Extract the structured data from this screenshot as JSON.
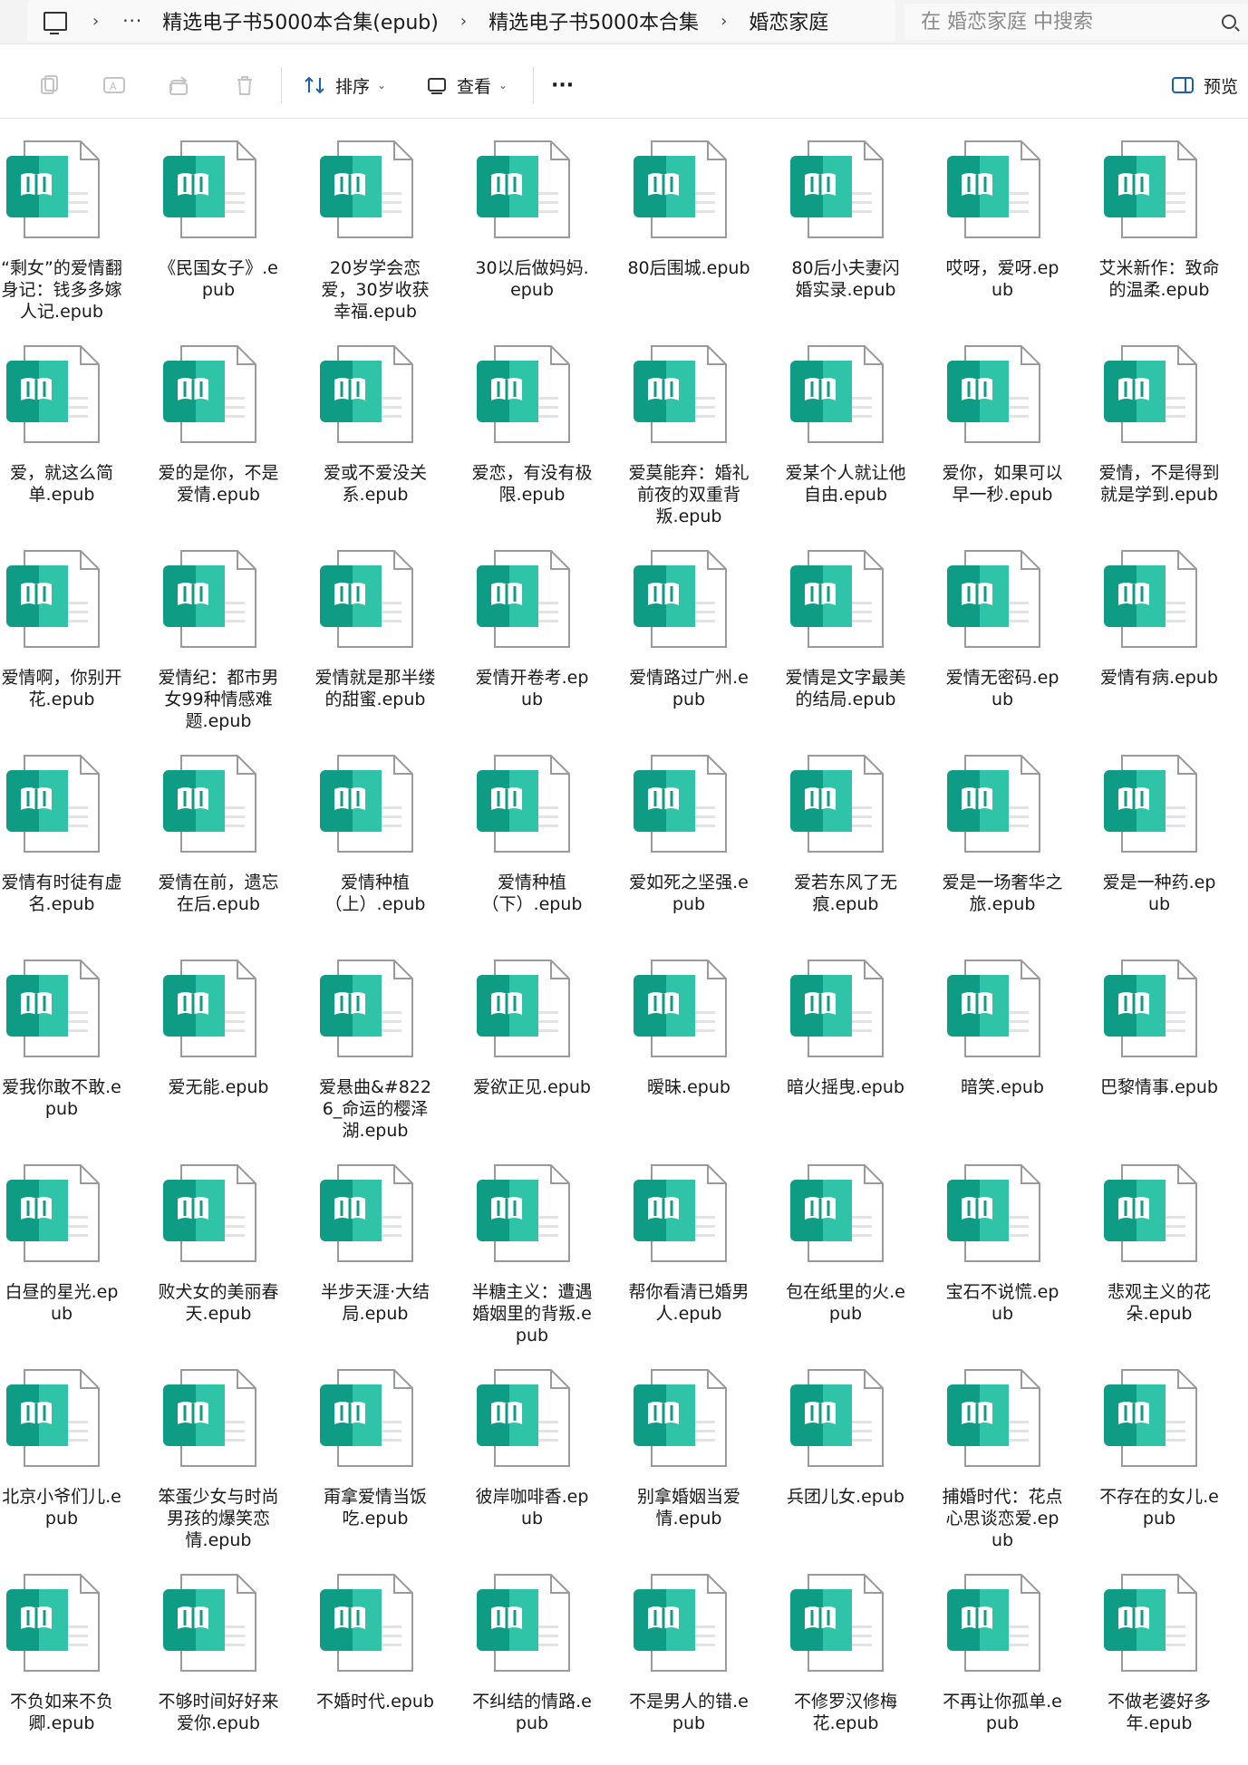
{
  "breadcrumb": {
    "more": "···",
    "items": [
      "精选电子书5000本合集(epub)",
      "精选电子书5000本合集",
      "婚恋家庭"
    ],
    "separator": "›"
  },
  "search": {
    "placeholder": "在 婚恋家庭 中搜索"
  },
  "toolbar": {
    "sort_label": "排序",
    "view_label": "查看",
    "more_label": "···",
    "preview_label": "预览"
  },
  "colors": {
    "icon_dark": "#0f9c85",
    "icon_light": "#2fc4a7",
    "page": "#ffffff",
    "page_border": "#9a9a9a"
  },
  "files": [
    "“剩女”的爱情翻身记：钱多多嫁人记.epub",
    "《民国女子》.epub",
    "20岁学会恋爱，30岁收获幸福.epub",
    "30以后做妈妈.epub",
    "80后围城.epub",
    "80后小夫妻闪婚实录.epub",
    "哎呀，爱呀.epub",
    "艾米新作：致命的温柔.epub",
    "爱，就这么简单.epub",
    "爱的是你，不是爱情.epub",
    "爱或不爱没关系.epub",
    "爱恋，有没有极限.epub",
    "爱莫能弃：婚礼前夜的双重背叛.epub",
    "爱某个人就让他自由.epub",
    "爱你，如果可以早一秒.epub",
    "爱情，不是得到就是学到.epub",
    "爱情啊，你别开花.epub",
    "爱情纪：都市男女99种情感难题.epub",
    "爱情就是那半缕的甜蜜.epub",
    "爱情开卷考.epub",
    "爱情路过广州.epub",
    "爱情是文字最美的结局.epub",
    "爱情无密码.epub",
    "爱情有病.epub",
    "爱情有时徒有虚名.epub",
    "爱情在前，遗忘在后.epub",
    "爱情种植（上）.epub",
    "爱情种植（下）.epub",
    "爱如死之坚强.epub",
    "爱若东风了无痕.epub",
    "爱是一场奢华之旅.epub",
    "爱是一种药.epub",
    "爱我你敢不敢.epub",
    "爱无能.epub",
    "爱悬曲&#8226_命运的樱泽湖.epub",
    "爱欲正见.epub",
    "暧昧.epub",
    "暗火摇曳.epub",
    "暗笑.epub",
    "巴黎情事.epub",
    "白昼的星光.epub",
    "败犬女的美丽春天.epub",
    "半步天涯·大结局.epub",
    "半糖主义：遭遇婚姻里的背叛.epub",
    "帮你看清已婚男人.epub",
    "包在纸里的火.epub",
    "宝石不说慌.epub",
    "悲观主义的花朵.epub",
    "北京小爷们儿.epub",
    "笨蛋少女与时尚男孩的爆笑恋情.epub",
    "甭拿爱情当饭吃.epub",
    "彼岸咖啡香.epub",
    "别拿婚姻当爱情.epub",
    "兵团儿女.epub",
    "捕婚时代：花点心思谈恋爱.epub",
    "不存在的女儿.epub",
    "不负如来不负卿.epub",
    "不够时间好好来爱你.epub",
    "不婚时代.epub",
    "不纠结的情路.epub",
    "不是男人的错.epub",
    "不修罗汉修梅花.epub",
    "不再让你孤单.epub",
    "不做老婆好多年.epub"
  ]
}
